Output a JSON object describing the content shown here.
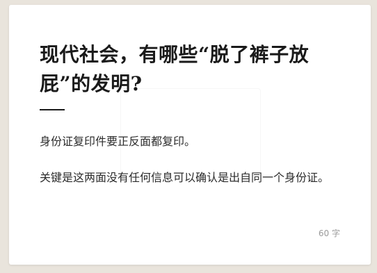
{
  "card": {
    "title": "现代社会，有哪些“脱了裤子放屁”的发明?",
    "paragraphs": [
      "身份证复印件要正反面都复印。",
      "关键是这两面没有任何信息可以确认是出自同一个身份证。"
    ],
    "char_count": "60 字"
  }
}
